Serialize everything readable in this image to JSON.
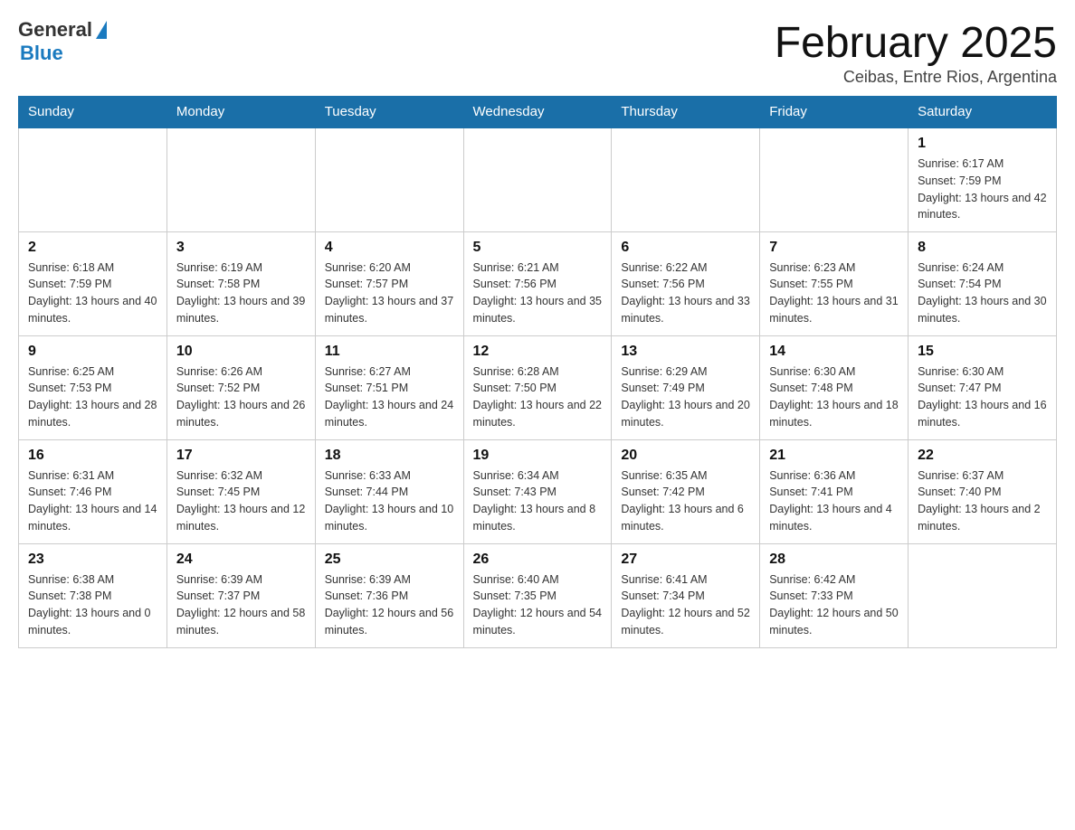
{
  "logo": {
    "general": "General",
    "blue": "Blue"
  },
  "title": "February 2025",
  "subtitle": "Ceibas, Entre Rios, Argentina",
  "days_of_week": [
    "Sunday",
    "Monday",
    "Tuesday",
    "Wednesday",
    "Thursday",
    "Friday",
    "Saturday"
  ],
  "weeks": [
    [
      {
        "day": "",
        "info": ""
      },
      {
        "day": "",
        "info": ""
      },
      {
        "day": "",
        "info": ""
      },
      {
        "day": "",
        "info": ""
      },
      {
        "day": "",
        "info": ""
      },
      {
        "day": "",
        "info": ""
      },
      {
        "day": "1",
        "info": "Sunrise: 6:17 AM\nSunset: 7:59 PM\nDaylight: 13 hours and 42 minutes."
      }
    ],
    [
      {
        "day": "2",
        "info": "Sunrise: 6:18 AM\nSunset: 7:59 PM\nDaylight: 13 hours and 40 minutes."
      },
      {
        "day": "3",
        "info": "Sunrise: 6:19 AM\nSunset: 7:58 PM\nDaylight: 13 hours and 39 minutes."
      },
      {
        "day": "4",
        "info": "Sunrise: 6:20 AM\nSunset: 7:57 PM\nDaylight: 13 hours and 37 minutes."
      },
      {
        "day": "5",
        "info": "Sunrise: 6:21 AM\nSunset: 7:56 PM\nDaylight: 13 hours and 35 minutes."
      },
      {
        "day": "6",
        "info": "Sunrise: 6:22 AM\nSunset: 7:56 PM\nDaylight: 13 hours and 33 minutes."
      },
      {
        "day": "7",
        "info": "Sunrise: 6:23 AM\nSunset: 7:55 PM\nDaylight: 13 hours and 31 minutes."
      },
      {
        "day": "8",
        "info": "Sunrise: 6:24 AM\nSunset: 7:54 PM\nDaylight: 13 hours and 30 minutes."
      }
    ],
    [
      {
        "day": "9",
        "info": "Sunrise: 6:25 AM\nSunset: 7:53 PM\nDaylight: 13 hours and 28 minutes."
      },
      {
        "day": "10",
        "info": "Sunrise: 6:26 AM\nSunset: 7:52 PM\nDaylight: 13 hours and 26 minutes."
      },
      {
        "day": "11",
        "info": "Sunrise: 6:27 AM\nSunset: 7:51 PM\nDaylight: 13 hours and 24 minutes."
      },
      {
        "day": "12",
        "info": "Sunrise: 6:28 AM\nSunset: 7:50 PM\nDaylight: 13 hours and 22 minutes."
      },
      {
        "day": "13",
        "info": "Sunrise: 6:29 AM\nSunset: 7:49 PM\nDaylight: 13 hours and 20 minutes."
      },
      {
        "day": "14",
        "info": "Sunrise: 6:30 AM\nSunset: 7:48 PM\nDaylight: 13 hours and 18 minutes."
      },
      {
        "day": "15",
        "info": "Sunrise: 6:30 AM\nSunset: 7:47 PM\nDaylight: 13 hours and 16 minutes."
      }
    ],
    [
      {
        "day": "16",
        "info": "Sunrise: 6:31 AM\nSunset: 7:46 PM\nDaylight: 13 hours and 14 minutes."
      },
      {
        "day": "17",
        "info": "Sunrise: 6:32 AM\nSunset: 7:45 PM\nDaylight: 13 hours and 12 minutes."
      },
      {
        "day": "18",
        "info": "Sunrise: 6:33 AM\nSunset: 7:44 PM\nDaylight: 13 hours and 10 minutes."
      },
      {
        "day": "19",
        "info": "Sunrise: 6:34 AM\nSunset: 7:43 PM\nDaylight: 13 hours and 8 minutes."
      },
      {
        "day": "20",
        "info": "Sunrise: 6:35 AM\nSunset: 7:42 PM\nDaylight: 13 hours and 6 minutes."
      },
      {
        "day": "21",
        "info": "Sunrise: 6:36 AM\nSunset: 7:41 PM\nDaylight: 13 hours and 4 minutes."
      },
      {
        "day": "22",
        "info": "Sunrise: 6:37 AM\nSunset: 7:40 PM\nDaylight: 13 hours and 2 minutes."
      }
    ],
    [
      {
        "day": "23",
        "info": "Sunrise: 6:38 AM\nSunset: 7:38 PM\nDaylight: 13 hours and 0 minutes."
      },
      {
        "day": "24",
        "info": "Sunrise: 6:39 AM\nSunset: 7:37 PM\nDaylight: 12 hours and 58 minutes."
      },
      {
        "day": "25",
        "info": "Sunrise: 6:39 AM\nSunset: 7:36 PM\nDaylight: 12 hours and 56 minutes."
      },
      {
        "day": "26",
        "info": "Sunrise: 6:40 AM\nSunset: 7:35 PM\nDaylight: 12 hours and 54 minutes."
      },
      {
        "day": "27",
        "info": "Sunrise: 6:41 AM\nSunset: 7:34 PM\nDaylight: 12 hours and 52 minutes."
      },
      {
        "day": "28",
        "info": "Sunrise: 6:42 AM\nSunset: 7:33 PM\nDaylight: 12 hours and 50 minutes."
      },
      {
        "day": "",
        "info": ""
      }
    ]
  ]
}
